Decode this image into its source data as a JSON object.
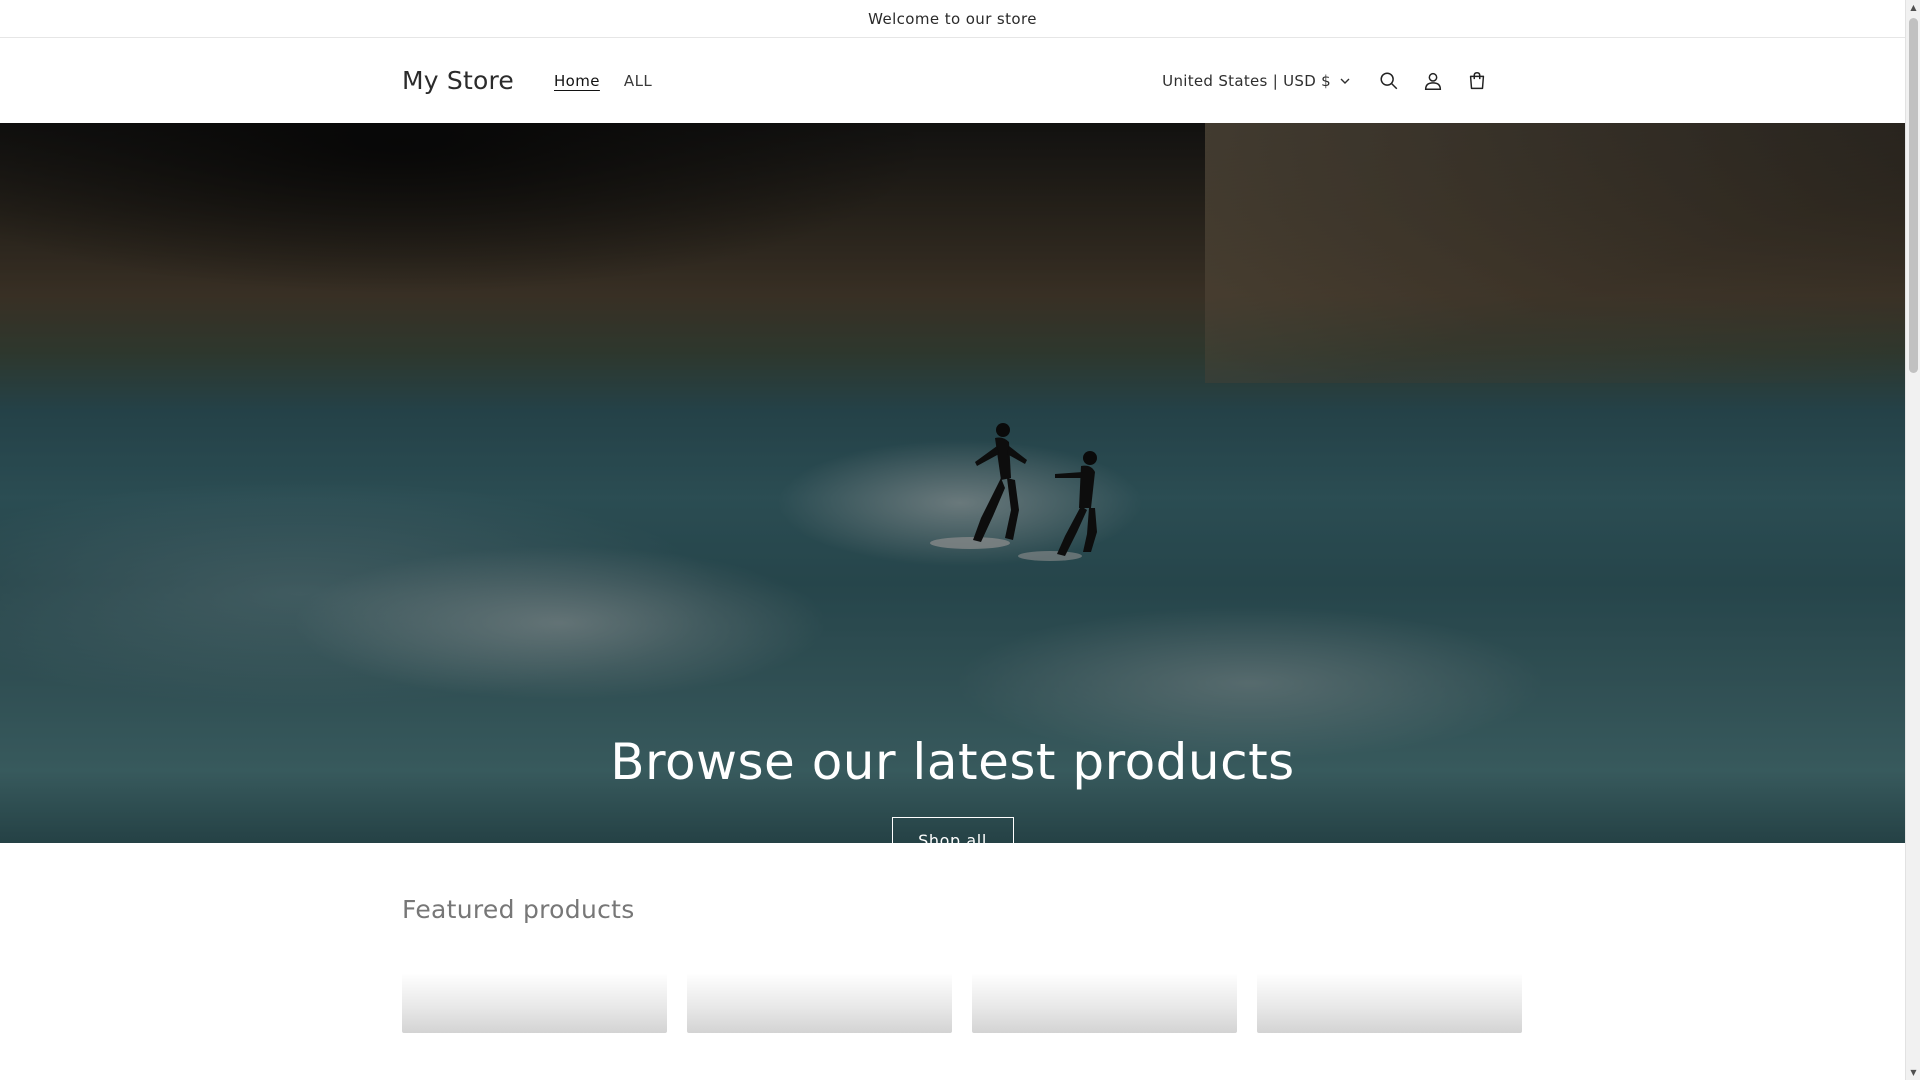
{
  "announcement": {
    "text": "Welcome to our store"
  },
  "header": {
    "logo": "My Store",
    "nav": [
      {
        "label": "Home",
        "active": true
      },
      {
        "label": "ALL",
        "active": false
      }
    ],
    "country_selector": "United States | USD $",
    "icons": [
      "search-icon",
      "account-icon",
      "cart-icon"
    ]
  },
  "hero": {
    "title": "Browse our latest products",
    "button_label": "Shop all"
  },
  "featured": {
    "title": "Featured products"
  },
  "colors": {
    "accent": "#121212",
    "hero_button_border": "#ffffff",
    "muted_heading": "#777777"
  }
}
